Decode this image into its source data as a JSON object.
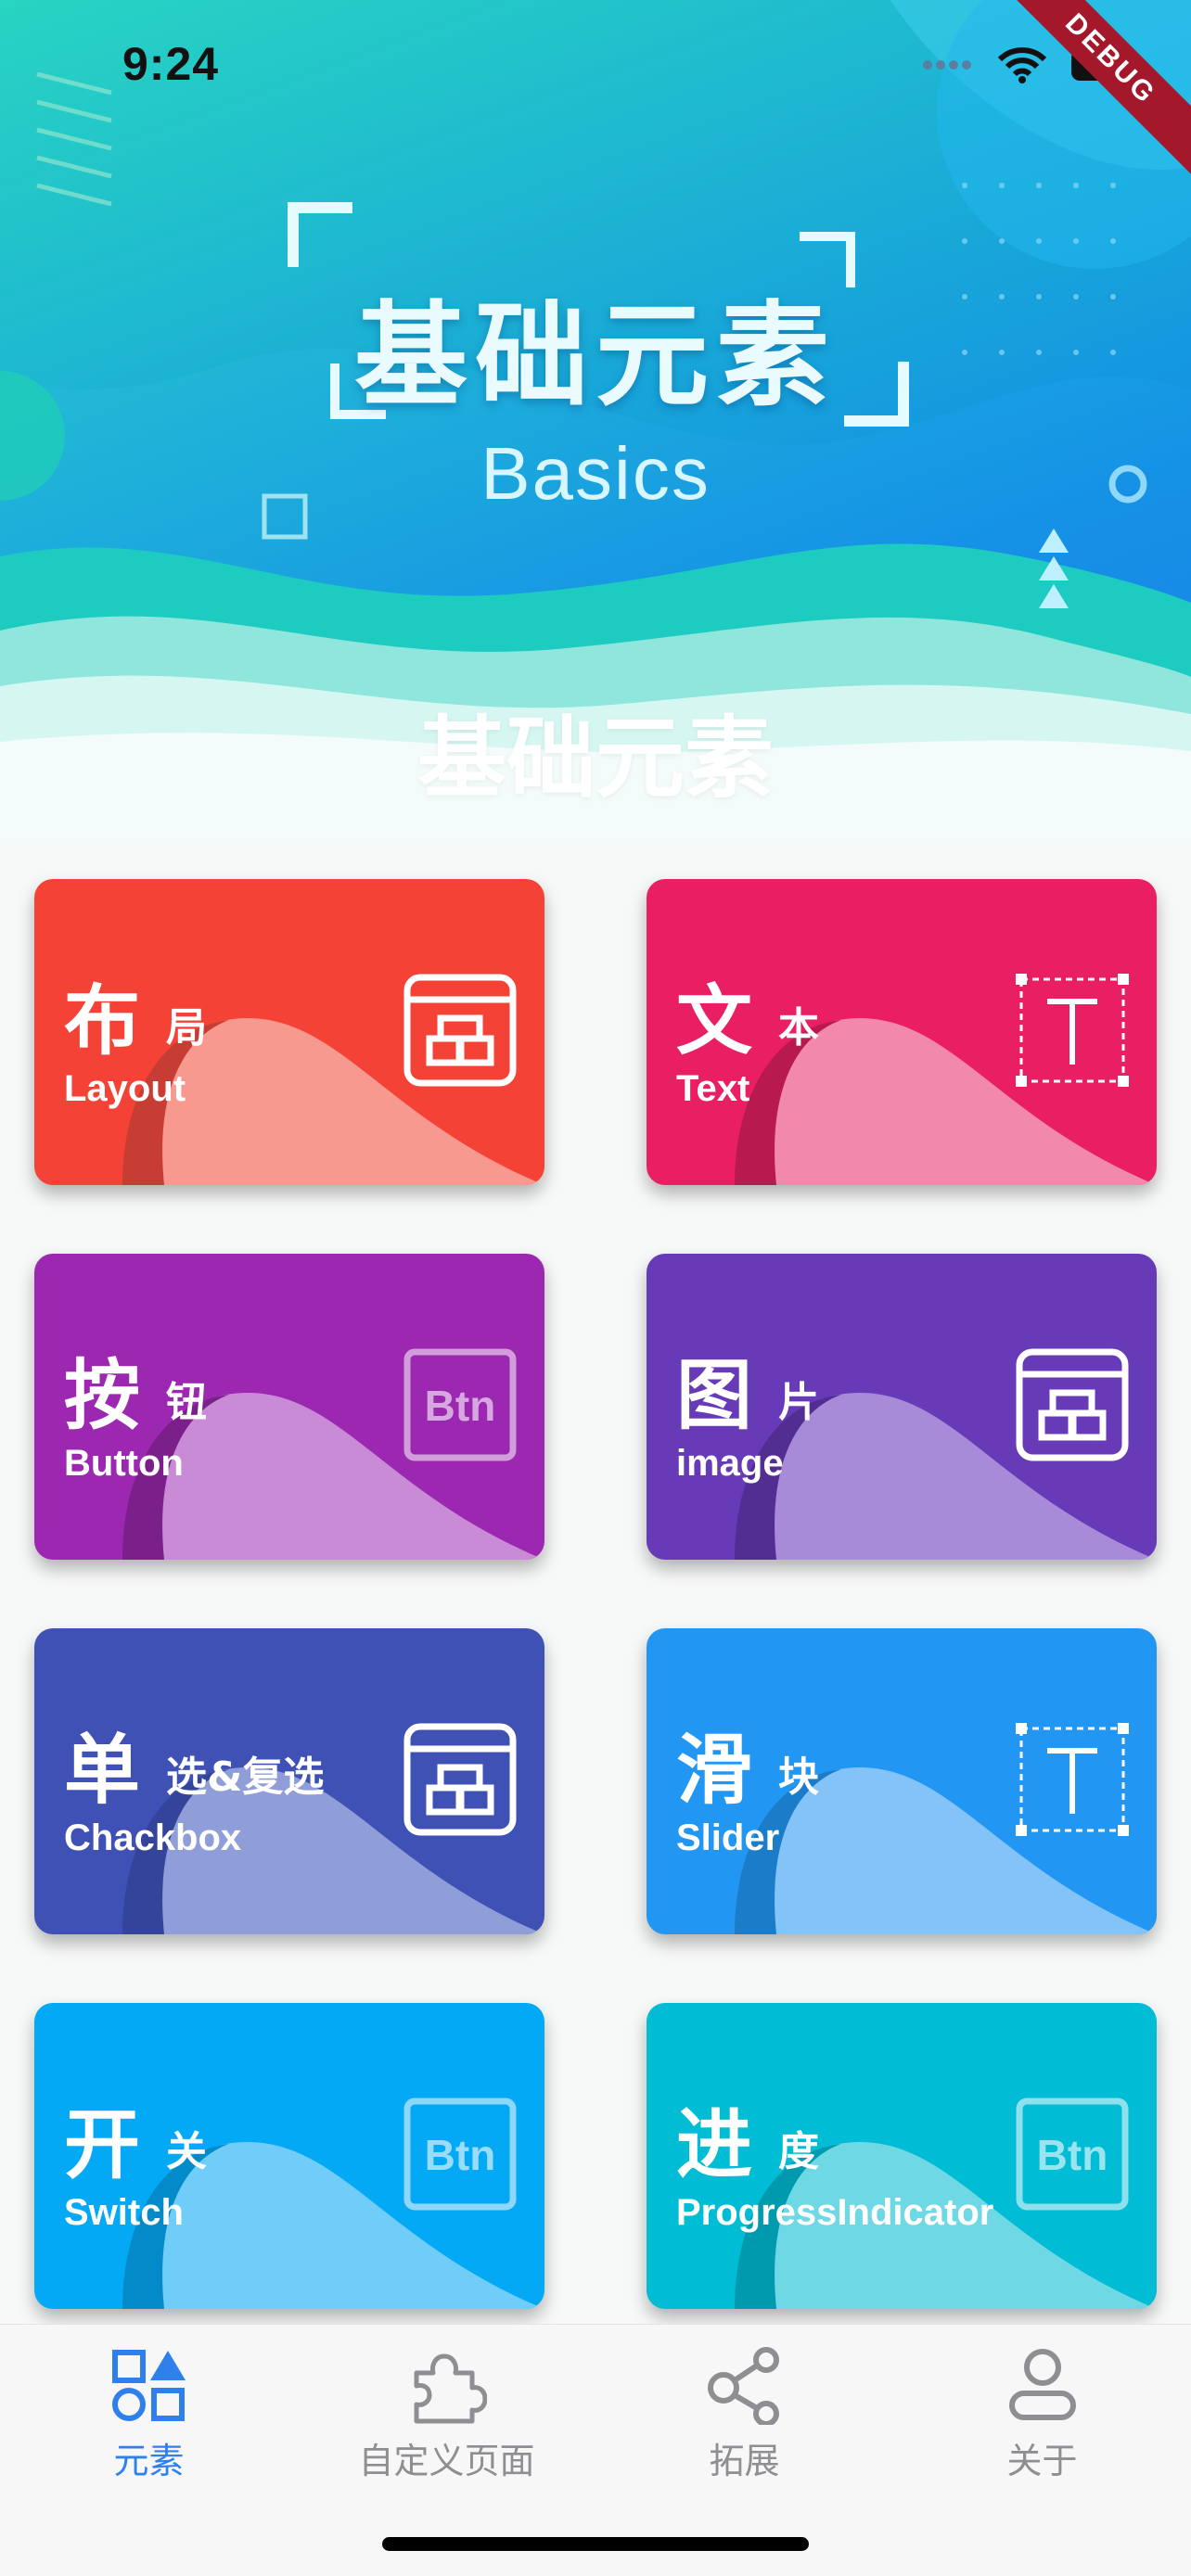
{
  "status_bar": {
    "time": "9:24",
    "debug_label": "DEBUG"
  },
  "banner": {
    "title_cn": "基础元素",
    "title_en": "Basics",
    "overlay_title": "基础元素"
  },
  "cards": [
    {
      "big": "布",
      "small": "局",
      "en": "Layout",
      "color": "#f44336",
      "wave_dark": "#c73c33",
      "wave_light": "#f8998f",
      "icon": "window-layout-icon"
    },
    {
      "big": "文",
      "small": "本",
      "en": "Text",
      "color": "#e91e63",
      "wave_dark": "#b8194e",
      "wave_light": "#f289ad",
      "icon": "text-box-icon"
    },
    {
      "big": "按",
      "small": "钮",
      "en": "Button",
      "color": "#9c27b0",
      "wave_dark": "#7b1f8b",
      "wave_light": "#c98bd6",
      "icon": "btn-icon"
    },
    {
      "big": "图",
      "small": "片",
      "en": "image",
      "color": "#673ab7",
      "wave_dark": "#522e92",
      "wave_light": "#a78ad8",
      "icon": "window-layout-icon"
    },
    {
      "big": "单",
      "small": "选&复选",
      "en": "Chackbox",
      "color": "#3f51b5",
      "wave_dark": "#34449a",
      "wave_light": "#8f9dd8",
      "icon": "window-layout-icon"
    },
    {
      "big": "滑",
      "small": "块",
      "en": "Slider",
      "color": "#2196f3",
      "wave_dark": "#1b7cc9",
      "wave_light": "#84c3f8",
      "icon": "text-box-icon"
    },
    {
      "big": "开",
      "small": "关",
      "en": "Switch",
      "color": "#03a9f4",
      "wave_dark": "#038bc9",
      "wave_light": "#6fcdf8",
      "icon": "btn-icon"
    },
    {
      "big": "进",
      "small": "度",
      "en": "ProgressIndicator",
      "color": "#00bcd4",
      "wave_dark": "#009aae",
      "wave_light": "#6fd8e5",
      "icon": "btn-icon"
    }
  ],
  "tabs": [
    {
      "label": "元素",
      "icon": "shapes-icon",
      "active": true
    },
    {
      "label": "自定义页面",
      "icon": "puzzle-icon",
      "active": false
    },
    {
      "label": "拓展",
      "icon": "share-icon",
      "active": false
    },
    {
      "label": "关于",
      "icon": "user-icon",
      "active": false
    }
  ],
  "colors": {
    "active_tab": "#2f80ed",
    "inactive_tab": "#8e8e93"
  }
}
